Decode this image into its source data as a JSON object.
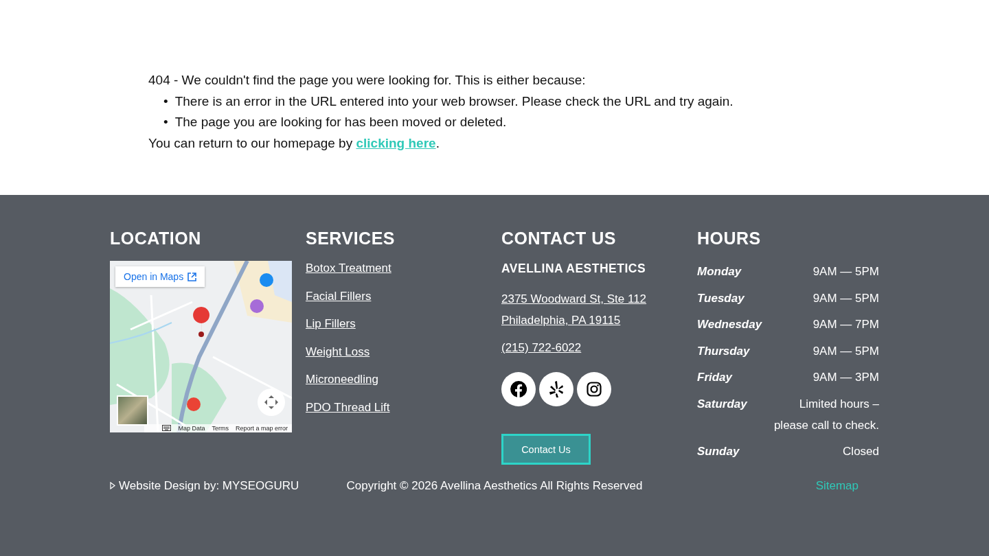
{
  "error": {
    "intro": "404 - We couldn't find the page you were looking for. This is either because:",
    "reasons": [
      {
        "marker": "•",
        "text": "There is an error in the URL entered into your web browser. Please check the URL and try again."
      },
      {
        "marker": "•",
        "text": "The page you are looking for has been moved or deleted."
      }
    ],
    "return_text": "You can return to our homepage by ",
    "return_link": "clicking here",
    "return_end": "."
  },
  "footer": {
    "location": {
      "heading": "LOCATION",
      "map": {
        "kind": "picture",
        "open_button": "Open in Maps",
        "attribution": [
          "Map Data",
          "Terms",
          "Report a map error"
        ]
      }
    },
    "services": {
      "heading": "SERVICES",
      "links": [
        "Botox Treatment",
        "Facial Fillers",
        "Lip Fillers",
        "Weight Loss",
        "Microneedling",
        "PDO Thread Lift"
      ]
    },
    "contact": {
      "heading": "CONTACT US",
      "name": "AVELLINA AESTHETICS",
      "address": [
        "2375 Woodward St, Ste 112",
        "Philadelphia, PA 19115"
      ],
      "phone": "(215) 722-6022",
      "social": [
        {
          "kind": "facebook"
        },
        {
          "kind": "yelp"
        },
        {
          "kind": "instagram"
        }
      ],
      "button": "Contact Us"
    },
    "hours": {
      "heading": "HOURS",
      "days": [
        {
          "day": "Monday",
          "time": "9AM — 5PM"
        },
        {
          "day": "Tuesday",
          "time": "9AM — 5PM"
        },
        {
          "day": "Wednesday",
          "time": "9AM — 7PM"
        },
        {
          "day": "Thursday",
          "time": "9AM — 5PM"
        },
        {
          "day": "Friday",
          "time": "9AM — 3PM"
        },
        {
          "day": "Saturday",
          "time": "Limited hours – please call to check."
        },
        {
          "day": "Sunday",
          "time": "Closed"
        }
      ]
    },
    "credit": "Website Design by: MYSEOGURU",
    "copyright": "Copyright © 2026 Avellina Aesthetics All Rights Reserved",
    "sitemap": "Sitemap"
  }
}
